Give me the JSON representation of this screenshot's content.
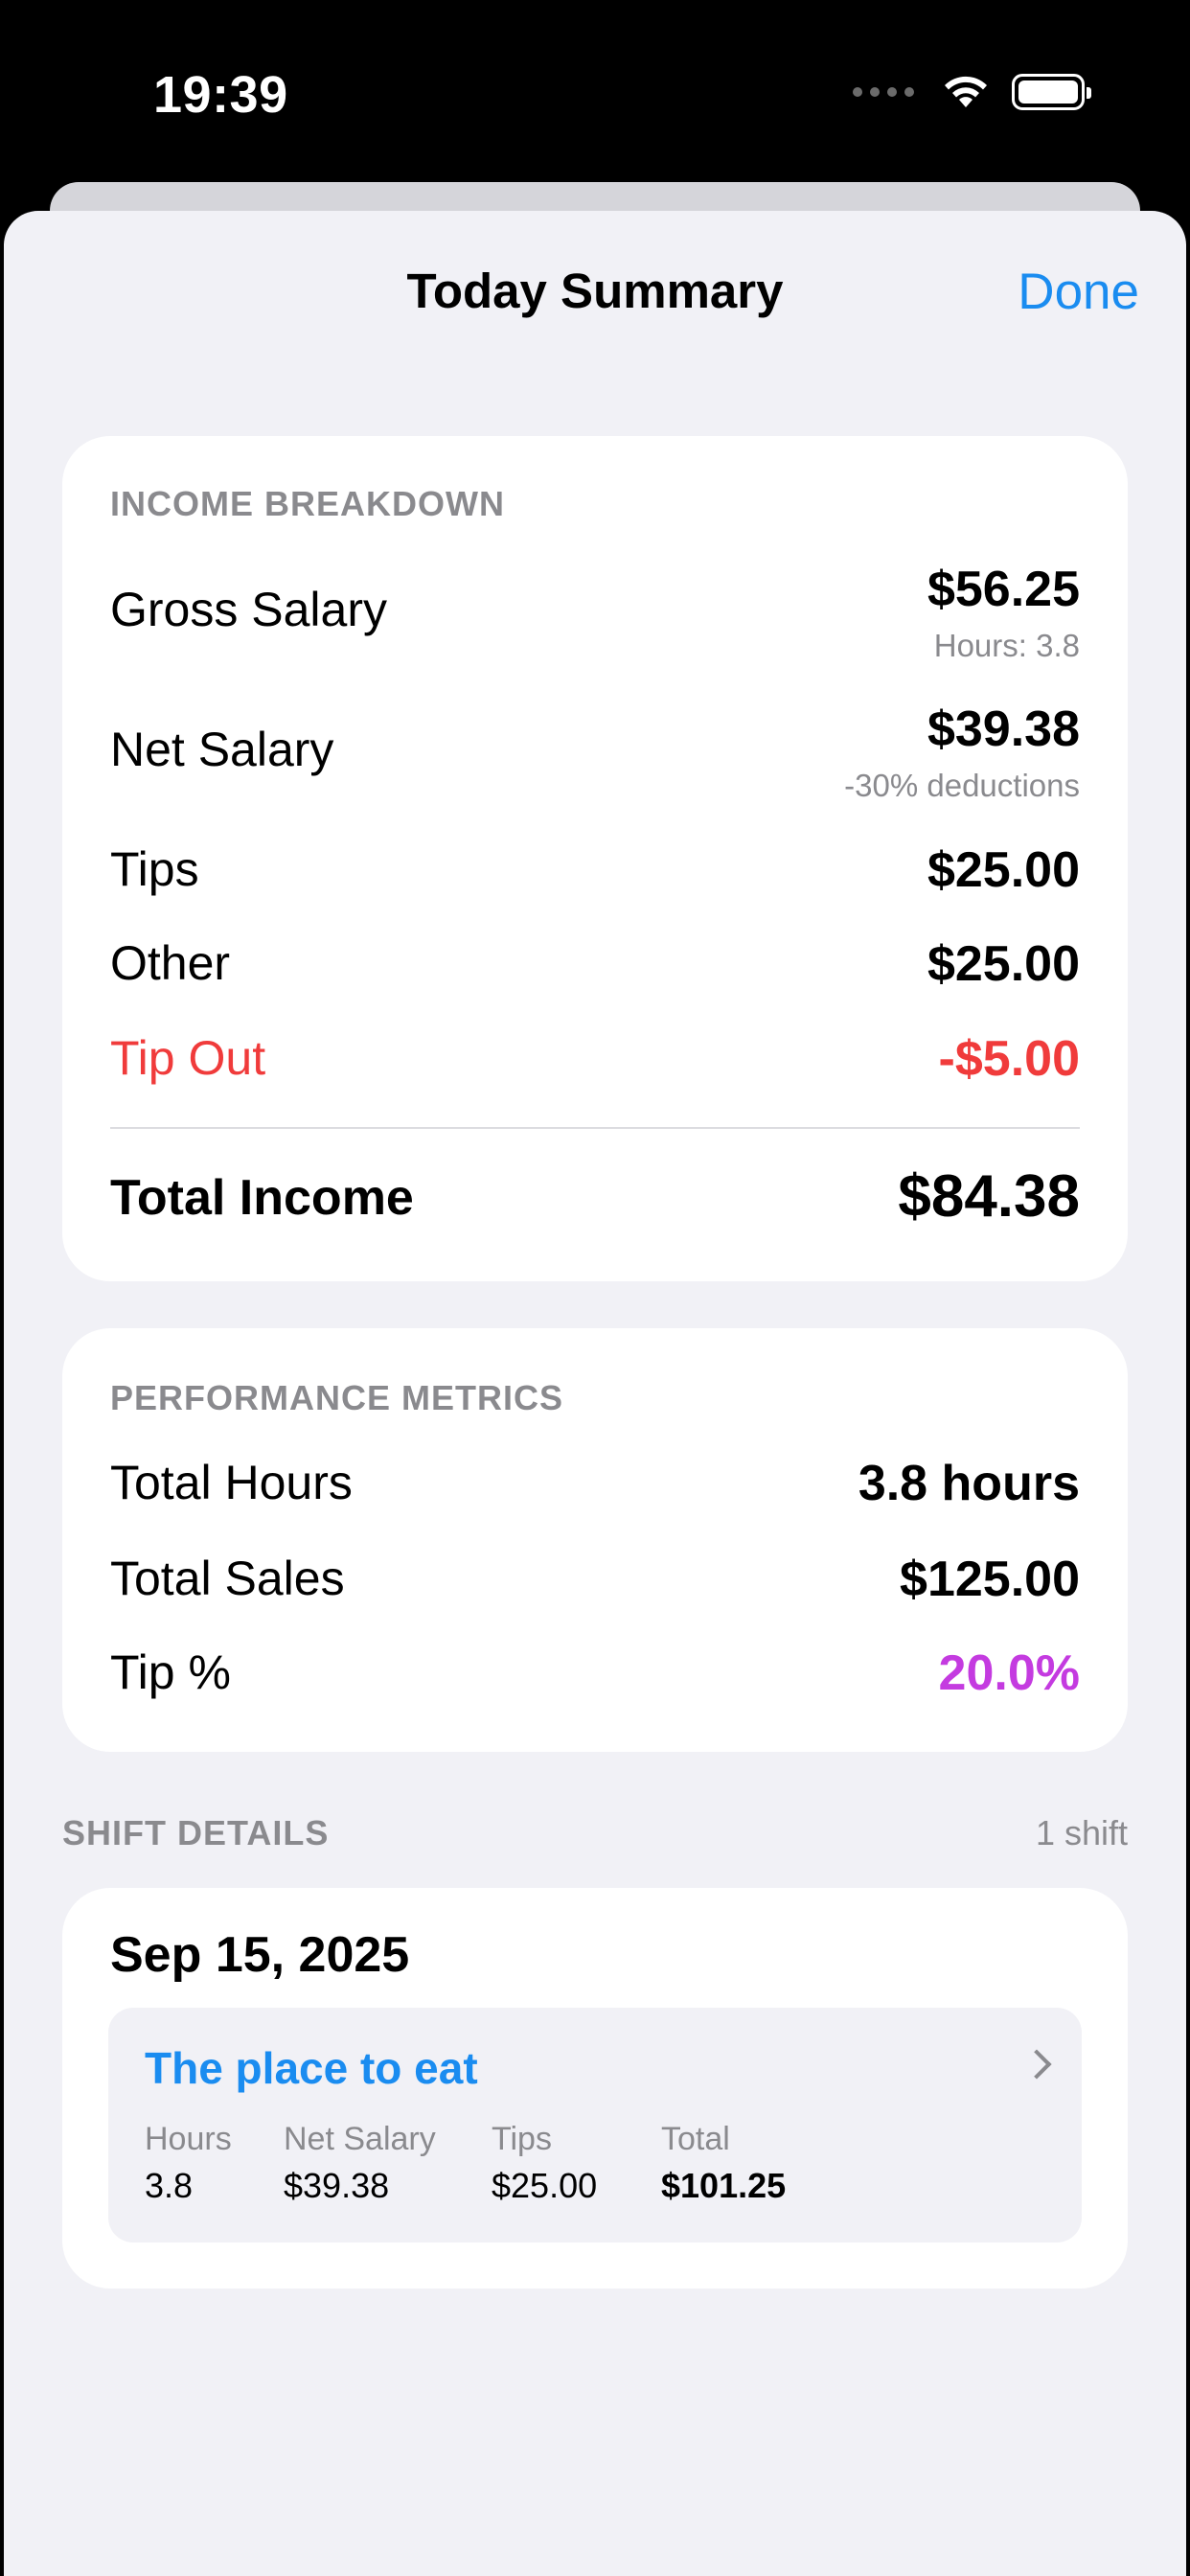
{
  "status_bar": {
    "time": "19:39"
  },
  "nav": {
    "title": "Today Summary",
    "done_label": "Done"
  },
  "income": {
    "header": "INCOME BREAKDOWN",
    "gross_label": "Gross Salary",
    "gross_value": "$56.25",
    "gross_sub": "Hours: 3.8",
    "net_label": "Net Salary",
    "net_value": "$39.38",
    "net_sub": "-30% deductions",
    "tips_label": "Tips",
    "tips_value": "$25.00",
    "other_label": "Other",
    "other_value": "$25.00",
    "tipout_label": "Tip Out",
    "tipout_value": "-$5.00",
    "total_label": "Total Income",
    "total_value": "$84.38"
  },
  "performance": {
    "header": "PERFORMANCE METRICS",
    "hours_label": "Total Hours",
    "hours_value": "3.8 hours",
    "sales_label": "Total Sales",
    "sales_value": "$125.00",
    "tip_pct_label": "Tip %",
    "tip_pct_value": "20.0%"
  },
  "shift_details": {
    "header": "SHIFT DETAILS",
    "count": "1 shift",
    "date": "Sep 15, 2025",
    "shift": {
      "name": "The place to eat",
      "hours_label": "Hours",
      "hours_value": "3.8",
      "net_label": "Net Salary",
      "net_value": "$39.38",
      "tips_label": "Tips",
      "tips_value": "$25.00",
      "total_label": "Total",
      "total_value": "$101.25"
    }
  },
  "colors": {
    "accent": "#1a8cf0",
    "negative": "#f03b3b",
    "tip_percent": "#c43be0"
  }
}
